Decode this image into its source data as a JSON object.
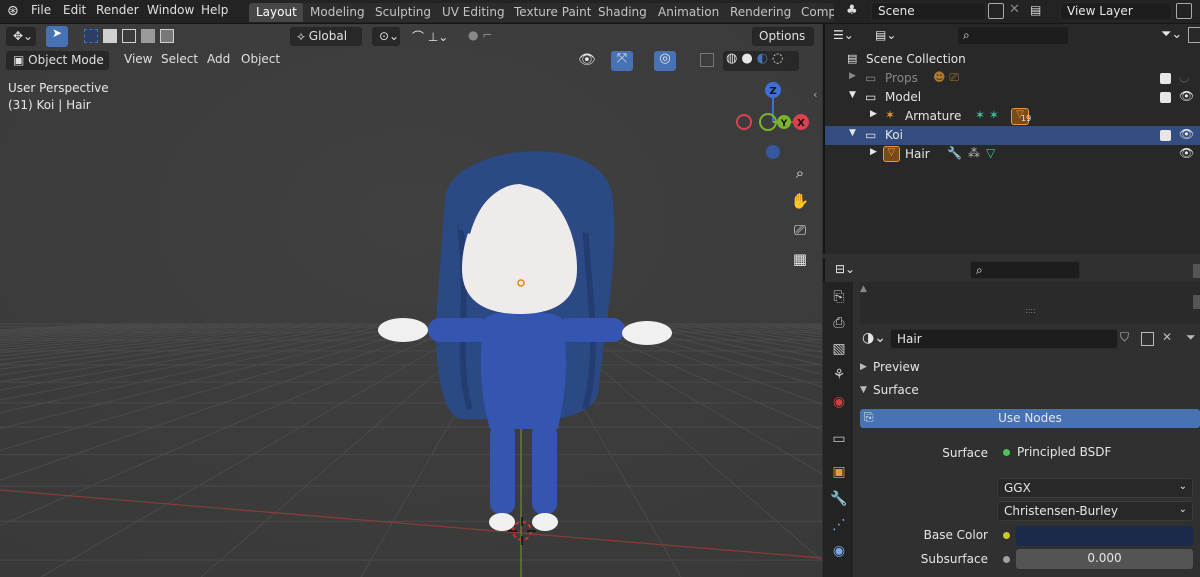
{
  "topbar": {
    "menus": [
      "File",
      "Edit",
      "Render",
      "Window",
      "Help"
    ],
    "workspaces": [
      "Layout",
      "Modeling",
      "Sculpting",
      "UV Editing",
      "Texture Paint",
      "Shading",
      "Animation",
      "Rendering",
      "Comp"
    ],
    "active_workspace": "Layout",
    "scene": "Scene",
    "view_layer": "View Layer"
  },
  "viewport": {
    "orientation": "Global",
    "options_label": "Options",
    "mode": "Object Mode",
    "menus": [
      "View",
      "Select",
      "Add",
      "Object"
    ],
    "overlay_line1": "User Perspective",
    "overlay_line2": "(31) Koi | Hair",
    "gizmo": {
      "z": "Z",
      "y": "Y",
      "x": "X"
    }
  },
  "outliner": {
    "root": "Scene Collection",
    "rows": [
      {
        "label": "Props",
        "dim": true
      },
      {
        "label": "Model",
        "dim": false
      },
      {
        "label": "Armature",
        "dim": false,
        "badge": "19"
      },
      {
        "label": "Koi",
        "dim": false,
        "selected": true
      },
      {
        "label": "Hair",
        "dim": false
      }
    ]
  },
  "properties": {
    "material_name": "Hair",
    "panels": {
      "preview": "Preview",
      "surface": "Surface"
    },
    "use_nodes": "Use Nodes",
    "surface_label": "Surface",
    "surface_value": "Principled BSDF",
    "distribution": "GGX",
    "subsurface_method": "Christensen-Burley",
    "base_color_label": "Base Color",
    "subsurface_label": "Subsurface",
    "subsurface_value": "0.000",
    "base_color_hex": "#1b2a4a",
    "dots_handle": "::::"
  },
  "colors": {
    "accent": "#4772b3",
    "selection": "#334d80",
    "hair": "#2b4a85",
    "suit": "#3556b0"
  }
}
